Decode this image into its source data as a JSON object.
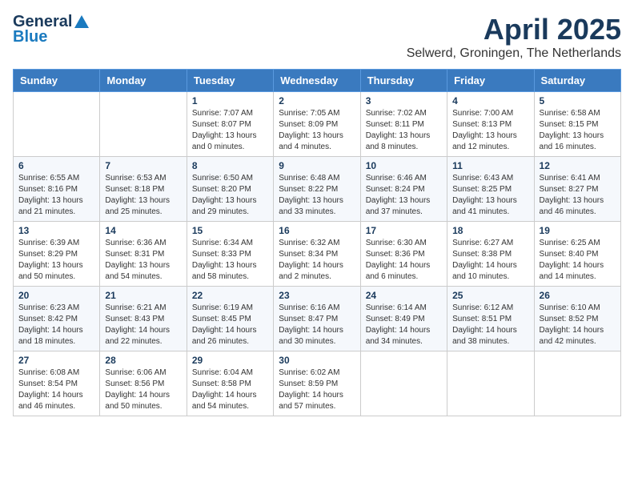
{
  "logo": {
    "general": "General",
    "blue": "Blue"
  },
  "title": {
    "month_year": "April 2025",
    "location": "Selwerd, Groningen, The Netherlands"
  },
  "days_of_week": [
    "Sunday",
    "Monday",
    "Tuesday",
    "Wednesday",
    "Thursday",
    "Friday",
    "Saturday"
  ],
  "weeks": [
    [
      {
        "day": "",
        "info": ""
      },
      {
        "day": "",
        "info": ""
      },
      {
        "day": "1",
        "info": "Sunrise: 7:07 AM\nSunset: 8:07 PM\nDaylight: 13 hours and 0 minutes."
      },
      {
        "day": "2",
        "info": "Sunrise: 7:05 AM\nSunset: 8:09 PM\nDaylight: 13 hours and 4 minutes."
      },
      {
        "day": "3",
        "info": "Sunrise: 7:02 AM\nSunset: 8:11 PM\nDaylight: 13 hours and 8 minutes."
      },
      {
        "day": "4",
        "info": "Sunrise: 7:00 AM\nSunset: 8:13 PM\nDaylight: 13 hours and 12 minutes."
      },
      {
        "day": "5",
        "info": "Sunrise: 6:58 AM\nSunset: 8:15 PM\nDaylight: 13 hours and 16 minutes."
      }
    ],
    [
      {
        "day": "6",
        "info": "Sunrise: 6:55 AM\nSunset: 8:16 PM\nDaylight: 13 hours and 21 minutes."
      },
      {
        "day": "7",
        "info": "Sunrise: 6:53 AM\nSunset: 8:18 PM\nDaylight: 13 hours and 25 minutes."
      },
      {
        "day": "8",
        "info": "Sunrise: 6:50 AM\nSunset: 8:20 PM\nDaylight: 13 hours and 29 minutes."
      },
      {
        "day": "9",
        "info": "Sunrise: 6:48 AM\nSunset: 8:22 PM\nDaylight: 13 hours and 33 minutes."
      },
      {
        "day": "10",
        "info": "Sunrise: 6:46 AM\nSunset: 8:24 PM\nDaylight: 13 hours and 37 minutes."
      },
      {
        "day": "11",
        "info": "Sunrise: 6:43 AM\nSunset: 8:25 PM\nDaylight: 13 hours and 41 minutes."
      },
      {
        "day": "12",
        "info": "Sunrise: 6:41 AM\nSunset: 8:27 PM\nDaylight: 13 hours and 46 minutes."
      }
    ],
    [
      {
        "day": "13",
        "info": "Sunrise: 6:39 AM\nSunset: 8:29 PM\nDaylight: 13 hours and 50 minutes."
      },
      {
        "day": "14",
        "info": "Sunrise: 6:36 AM\nSunset: 8:31 PM\nDaylight: 13 hours and 54 minutes."
      },
      {
        "day": "15",
        "info": "Sunrise: 6:34 AM\nSunset: 8:33 PM\nDaylight: 13 hours and 58 minutes."
      },
      {
        "day": "16",
        "info": "Sunrise: 6:32 AM\nSunset: 8:34 PM\nDaylight: 14 hours and 2 minutes."
      },
      {
        "day": "17",
        "info": "Sunrise: 6:30 AM\nSunset: 8:36 PM\nDaylight: 14 hours and 6 minutes."
      },
      {
        "day": "18",
        "info": "Sunrise: 6:27 AM\nSunset: 8:38 PM\nDaylight: 14 hours and 10 minutes."
      },
      {
        "day": "19",
        "info": "Sunrise: 6:25 AM\nSunset: 8:40 PM\nDaylight: 14 hours and 14 minutes."
      }
    ],
    [
      {
        "day": "20",
        "info": "Sunrise: 6:23 AM\nSunset: 8:42 PM\nDaylight: 14 hours and 18 minutes."
      },
      {
        "day": "21",
        "info": "Sunrise: 6:21 AM\nSunset: 8:43 PM\nDaylight: 14 hours and 22 minutes."
      },
      {
        "day": "22",
        "info": "Sunrise: 6:19 AM\nSunset: 8:45 PM\nDaylight: 14 hours and 26 minutes."
      },
      {
        "day": "23",
        "info": "Sunrise: 6:16 AM\nSunset: 8:47 PM\nDaylight: 14 hours and 30 minutes."
      },
      {
        "day": "24",
        "info": "Sunrise: 6:14 AM\nSunset: 8:49 PM\nDaylight: 14 hours and 34 minutes."
      },
      {
        "day": "25",
        "info": "Sunrise: 6:12 AM\nSunset: 8:51 PM\nDaylight: 14 hours and 38 minutes."
      },
      {
        "day": "26",
        "info": "Sunrise: 6:10 AM\nSunset: 8:52 PM\nDaylight: 14 hours and 42 minutes."
      }
    ],
    [
      {
        "day": "27",
        "info": "Sunrise: 6:08 AM\nSunset: 8:54 PM\nDaylight: 14 hours and 46 minutes."
      },
      {
        "day": "28",
        "info": "Sunrise: 6:06 AM\nSunset: 8:56 PM\nDaylight: 14 hours and 50 minutes."
      },
      {
        "day": "29",
        "info": "Sunrise: 6:04 AM\nSunset: 8:58 PM\nDaylight: 14 hours and 54 minutes."
      },
      {
        "day": "30",
        "info": "Sunrise: 6:02 AM\nSunset: 8:59 PM\nDaylight: 14 hours and 57 minutes."
      },
      {
        "day": "",
        "info": ""
      },
      {
        "day": "",
        "info": ""
      },
      {
        "day": "",
        "info": ""
      }
    ]
  ]
}
